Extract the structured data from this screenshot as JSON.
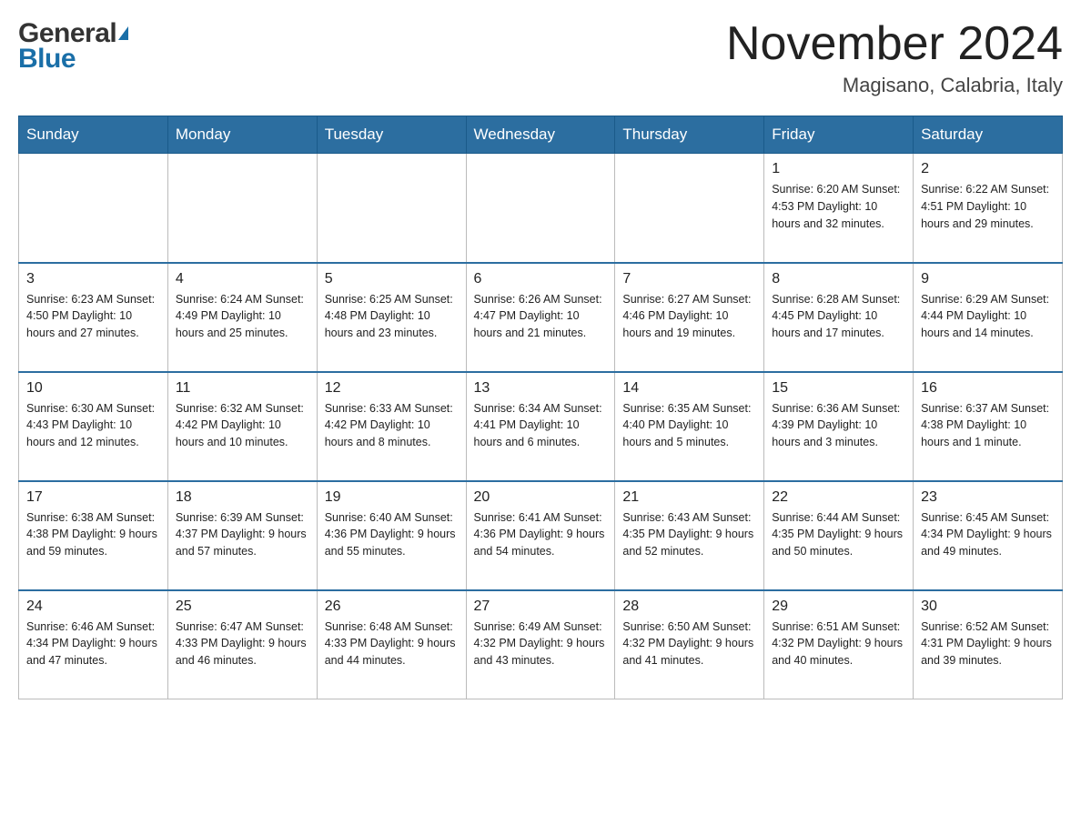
{
  "header": {
    "logo_general": "General",
    "logo_blue": "Blue",
    "month_title": "November 2024",
    "location": "Magisano, Calabria, Italy"
  },
  "weekdays": [
    "Sunday",
    "Monday",
    "Tuesday",
    "Wednesday",
    "Thursday",
    "Friday",
    "Saturday"
  ],
  "weeks": [
    {
      "days": [
        {
          "number": "",
          "info": ""
        },
        {
          "number": "",
          "info": ""
        },
        {
          "number": "",
          "info": ""
        },
        {
          "number": "",
          "info": ""
        },
        {
          "number": "",
          "info": ""
        },
        {
          "number": "1",
          "info": "Sunrise: 6:20 AM\nSunset: 4:53 PM\nDaylight: 10 hours\nand 32 minutes."
        },
        {
          "number": "2",
          "info": "Sunrise: 6:22 AM\nSunset: 4:51 PM\nDaylight: 10 hours\nand 29 minutes."
        }
      ]
    },
    {
      "days": [
        {
          "number": "3",
          "info": "Sunrise: 6:23 AM\nSunset: 4:50 PM\nDaylight: 10 hours\nand 27 minutes."
        },
        {
          "number": "4",
          "info": "Sunrise: 6:24 AM\nSunset: 4:49 PM\nDaylight: 10 hours\nand 25 minutes."
        },
        {
          "number": "5",
          "info": "Sunrise: 6:25 AM\nSunset: 4:48 PM\nDaylight: 10 hours\nand 23 minutes."
        },
        {
          "number": "6",
          "info": "Sunrise: 6:26 AM\nSunset: 4:47 PM\nDaylight: 10 hours\nand 21 minutes."
        },
        {
          "number": "7",
          "info": "Sunrise: 6:27 AM\nSunset: 4:46 PM\nDaylight: 10 hours\nand 19 minutes."
        },
        {
          "number": "8",
          "info": "Sunrise: 6:28 AM\nSunset: 4:45 PM\nDaylight: 10 hours\nand 17 minutes."
        },
        {
          "number": "9",
          "info": "Sunrise: 6:29 AM\nSunset: 4:44 PM\nDaylight: 10 hours\nand 14 minutes."
        }
      ]
    },
    {
      "days": [
        {
          "number": "10",
          "info": "Sunrise: 6:30 AM\nSunset: 4:43 PM\nDaylight: 10 hours\nand 12 minutes."
        },
        {
          "number": "11",
          "info": "Sunrise: 6:32 AM\nSunset: 4:42 PM\nDaylight: 10 hours\nand 10 minutes."
        },
        {
          "number": "12",
          "info": "Sunrise: 6:33 AM\nSunset: 4:42 PM\nDaylight: 10 hours\nand 8 minutes."
        },
        {
          "number": "13",
          "info": "Sunrise: 6:34 AM\nSunset: 4:41 PM\nDaylight: 10 hours\nand 6 minutes."
        },
        {
          "number": "14",
          "info": "Sunrise: 6:35 AM\nSunset: 4:40 PM\nDaylight: 10 hours\nand 5 minutes."
        },
        {
          "number": "15",
          "info": "Sunrise: 6:36 AM\nSunset: 4:39 PM\nDaylight: 10 hours\nand 3 minutes."
        },
        {
          "number": "16",
          "info": "Sunrise: 6:37 AM\nSunset: 4:38 PM\nDaylight: 10 hours\nand 1 minute."
        }
      ]
    },
    {
      "days": [
        {
          "number": "17",
          "info": "Sunrise: 6:38 AM\nSunset: 4:38 PM\nDaylight: 9 hours\nand 59 minutes."
        },
        {
          "number": "18",
          "info": "Sunrise: 6:39 AM\nSunset: 4:37 PM\nDaylight: 9 hours\nand 57 minutes."
        },
        {
          "number": "19",
          "info": "Sunrise: 6:40 AM\nSunset: 4:36 PM\nDaylight: 9 hours\nand 55 minutes."
        },
        {
          "number": "20",
          "info": "Sunrise: 6:41 AM\nSunset: 4:36 PM\nDaylight: 9 hours\nand 54 minutes."
        },
        {
          "number": "21",
          "info": "Sunrise: 6:43 AM\nSunset: 4:35 PM\nDaylight: 9 hours\nand 52 minutes."
        },
        {
          "number": "22",
          "info": "Sunrise: 6:44 AM\nSunset: 4:35 PM\nDaylight: 9 hours\nand 50 minutes."
        },
        {
          "number": "23",
          "info": "Sunrise: 6:45 AM\nSunset: 4:34 PM\nDaylight: 9 hours\nand 49 minutes."
        }
      ]
    },
    {
      "days": [
        {
          "number": "24",
          "info": "Sunrise: 6:46 AM\nSunset: 4:34 PM\nDaylight: 9 hours\nand 47 minutes."
        },
        {
          "number": "25",
          "info": "Sunrise: 6:47 AM\nSunset: 4:33 PM\nDaylight: 9 hours\nand 46 minutes."
        },
        {
          "number": "26",
          "info": "Sunrise: 6:48 AM\nSunset: 4:33 PM\nDaylight: 9 hours\nand 44 minutes."
        },
        {
          "number": "27",
          "info": "Sunrise: 6:49 AM\nSunset: 4:32 PM\nDaylight: 9 hours\nand 43 minutes."
        },
        {
          "number": "28",
          "info": "Sunrise: 6:50 AM\nSunset: 4:32 PM\nDaylight: 9 hours\nand 41 minutes."
        },
        {
          "number": "29",
          "info": "Sunrise: 6:51 AM\nSunset: 4:32 PM\nDaylight: 9 hours\nand 40 minutes."
        },
        {
          "number": "30",
          "info": "Sunrise: 6:52 AM\nSunset: 4:31 PM\nDaylight: 9 hours\nand 39 minutes."
        }
      ]
    }
  ]
}
